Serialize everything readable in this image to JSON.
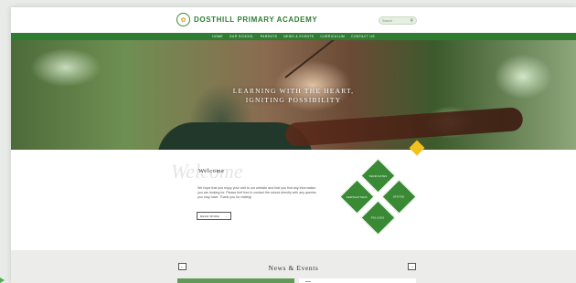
{
  "header": {
    "school_name": "DOSTHILL PRIMARY ACADEMY",
    "search_placeholder": "Search"
  },
  "nav": {
    "items": [
      "HOME",
      "OUR SCHOOL",
      "PARENTS",
      "NEWS & EVENTS",
      "CURRICULUM",
      "CONTACT US"
    ]
  },
  "hero": {
    "line1": "LEARNING WITH THE HEART,",
    "line2": "IGNITING POSSIBILITY"
  },
  "welcome": {
    "script_text": "Welcome",
    "heading": "Welcome",
    "intro": "We hope that you enjoy your visit to our website and that you find any information you are looking for. Please feel free to contact the school directly with any queries you may have. Thank you for visiting!",
    "read_more": "READ MORE"
  },
  "quicklinks": {
    "top": "TERM DATES",
    "left": "NEWSLETTERS",
    "right": "OFSTED",
    "bottom": "POLICIES"
  },
  "news": {
    "title": "News & Events"
  },
  "colors": {
    "brand_green": "#2e7d32",
    "accent_yellow": "#f1c21b"
  }
}
